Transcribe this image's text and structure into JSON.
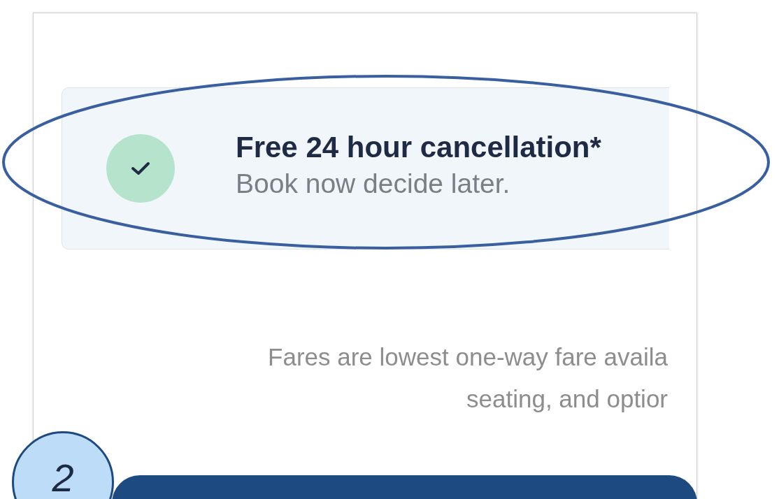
{
  "notice": {
    "title": "Free 24 hour cancellation*",
    "subtitle": "Book now decide later.",
    "checked": true
  },
  "fare_note": [
    "Fares are lowest one-way fare availa",
    "seating, and optior"
  ],
  "callout": {
    "number": "2"
  },
  "annotations": [
    {
      "kind": "ellipse"
    }
  ]
}
